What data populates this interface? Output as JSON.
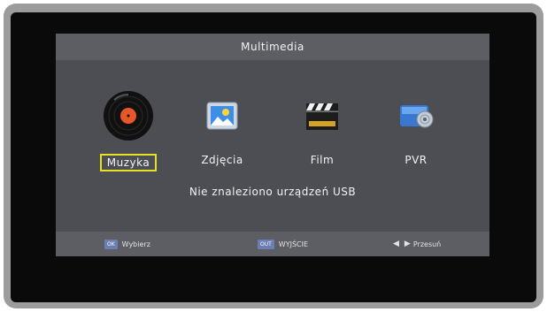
{
  "header": {
    "title": "Multimedia"
  },
  "items": [
    {
      "label": "Muzyka",
      "icon": "vinyl-record-icon",
      "selected": true
    },
    {
      "label": "Zdjęcia",
      "icon": "photo-icon",
      "selected": false
    },
    {
      "label": "Film",
      "icon": "clapperboard-icon",
      "selected": false
    },
    {
      "label": "PVR",
      "icon": "recorder-disc-icon",
      "selected": false
    }
  ],
  "status": {
    "message": "Nie znaleziono urządzeń USB"
  },
  "footer": {
    "select_key": "OK",
    "select_label": "Wybierz",
    "exit_key": "OUT",
    "exit_label": "WYJŚCIE",
    "move_label": "Przesuń"
  },
  "colors": {
    "highlight": "#e7e21f",
    "panel": "#4c4e53",
    "bar": "#5c5e63",
    "record_label": "#e8572a"
  }
}
